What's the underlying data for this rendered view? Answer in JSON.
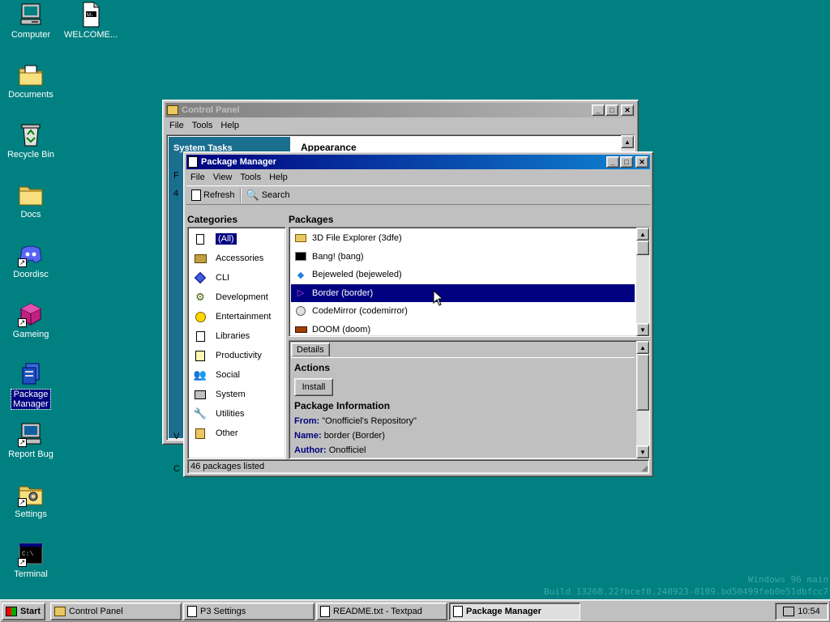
{
  "desktop": {
    "icons": [
      {
        "label": "Computer",
        "icon": "computer-icon"
      },
      {
        "label": "WELCOME...",
        "icon": "markdown-file-icon"
      },
      {
        "label": "Documents",
        "icon": "documents-folder-icon"
      },
      {
        "label": "Recycle Bin",
        "icon": "recycle-bin-icon"
      },
      {
        "label": "Docs",
        "icon": "folder-icon"
      },
      {
        "label": "Doordisc",
        "icon": "discord-icon"
      },
      {
        "label": "Gameing",
        "icon": "cube-icon"
      },
      {
        "label": "Package Manager",
        "label_line1": "Package",
        "label_line2": "Manager",
        "icon": "package-manager-icon"
      },
      {
        "label": "Report Bug",
        "icon": "report-bug-icon"
      },
      {
        "label": "Settings",
        "icon": "settings-folder-icon"
      },
      {
        "label": "Terminal",
        "icon": "terminal-icon"
      }
    ],
    "watermark_line1": "Windows 96 main",
    "watermark_line2": "Build 13268.22fbcef0.240923-0109.bd50499feb0e51dbfcc7"
  },
  "control_panel": {
    "title": "Control Panel",
    "menu": [
      "File",
      "Tools",
      "Help"
    ],
    "side_heading": "System Tasks",
    "content_heading": "Appearance",
    "peek_f": "F",
    "peek_4": "4",
    "peek_v": "V",
    "peek_c": "C"
  },
  "package_manager": {
    "title": "Package Manager",
    "menu": [
      "File",
      "View",
      "Tools",
      "Help"
    ],
    "toolbar": {
      "refresh": "Refresh",
      "search": "Search"
    },
    "categories_heading": "Categories",
    "packages_heading": "Packages",
    "categories": [
      {
        "label": "(All)",
        "icon": "all-icon",
        "selected": true
      },
      {
        "label": "Accessories",
        "icon": "accessories-icon"
      },
      {
        "label": "CLI",
        "icon": "cli-icon"
      },
      {
        "label": "Development",
        "icon": "development-icon"
      },
      {
        "label": "Entertainment",
        "icon": "entertainment-icon"
      },
      {
        "label": "Libraries",
        "icon": "libraries-icon"
      },
      {
        "label": "Productivity",
        "icon": "productivity-icon"
      },
      {
        "label": "Social",
        "icon": "social-icon"
      },
      {
        "label": "System",
        "icon": "system-icon"
      },
      {
        "label": "Utilities",
        "icon": "utilities-icon"
      },
      {
        "label": "Other",
        "icon": "other-icon"
      }
    ],
    "packages": [
      {
        "label": "3D File Explorer (3dfe)",
        "icon": "folder-icon"
      },
      {
        "label": "Bang! (bang)",
        "icon": "terminal-icon"
      },
      {
        "label": "Bejeweled (bejeweled)",
        "icon": "gem-icon"
      },
      {
        "label": "Border (border)",
        "icon": "border-icon",
        "selected": true
      },
      {
        "label": "CodeMirror (codemirror)",
        "icon": "codemirror-icon"
      },
      {
        "label": "DOOM (doom)",
        "icon": "doom-icon"
      }
    ],
    "details_tab": "Details",
    "actions_heading": "Actions",
    "install_button": "Install",
    "info_heading": "Package Information",
    "info": {
      "from_label": "From:",
      "from_value": "\"Onofficiel's Repository\"",
      "name_label": "Name:",
      "name_value": "border (Border)",
      "author_label": "Author:",
      "author_value": "Onofficiel"
    },
    "status": "46 packages listed"
  },
  "taskbar": {
    "start": "Start",
    "tasks": [
      {
        "label": "Control Panel",
        "icon": "control-panel-icon"
      },
      {
        "label": "P3 Settings",
        "icon": "settings-icon"
      },
      {
        "label": "README.txt - Textpad",
        "icon": "textpad-icon"
      },
      {
        "label": "Package Manager",
        "icon": "package-icon",
        "active": true
      }
    ],
    "clock": "10:54"
  },
  "colors": {
    "desktop": "#008080",
    "title_active": "#000080",
    "title_gradient_end": "#1084d0",
    "selection": "#000080",
    "face": "#c0c0c0"
  }
}
